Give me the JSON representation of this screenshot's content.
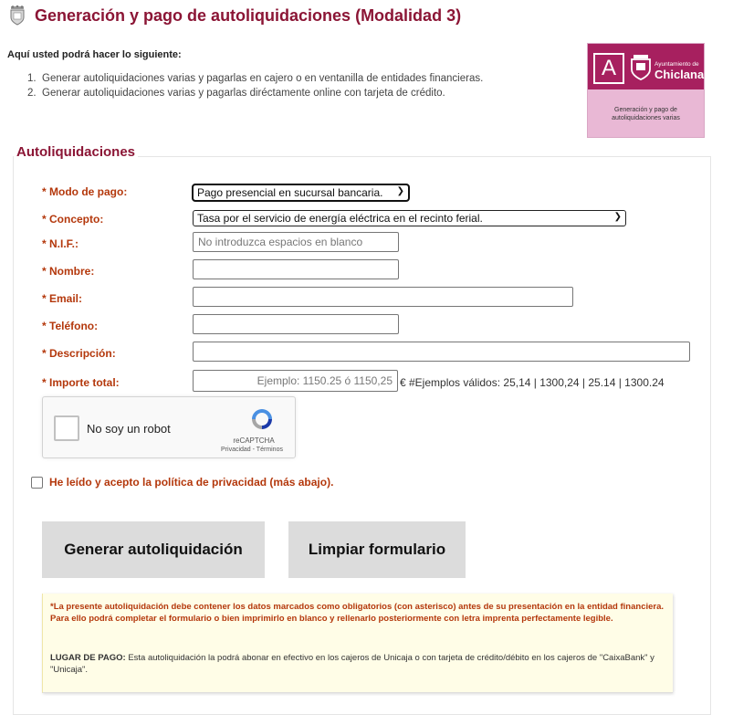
{
  "header": {
    "title": "Generación y pago de autoliquidaciones (Modalidad 3)"
  },
  "intro": {
    "heading": "Aquí usted podrá hacer lo siguiente:",
    "items": [
      {
        "num": "1.",
        "text": "Generar autoliquidaciones varias y pagarlas en cajero o en ventanilla de entidades financieras."
      },
      {
        "num": "2.",
        "text": "Generar autoliquidaciones varias y pagarlas diréctamente online con tarjeta de crédito."
      }
    ]
  },
  "logo": {
    "letter": "A",
    "small": "Ayuntamiento de",
    "city": "Chiclana",
    "caption_line1": "Generación y pago de",
    "caption_line2": "autoliquidaciones varias"
  },
  "form": {
    "legend": "Autoliquidaciones",
    "fields": {
      "modo_pago": {
        "label": "* Modo de pago:",
        "value": "Pago presencial en sucursal bancaria."
      },
      "concepto": {
        "label": "* Concepto:",
        "value": "Tasa por el servicio de energía eléctrica en el recinto ferial."
      },
      "nif": {
        "label": "* N.I.F.:",
        "placeholder": "No introduzca espacios en blanco"
      },
      "nombre": {
        "label": "* Nombre:",
        "value": ""
      },
      "email": {
        "label": "* Email:",
        "value": ""
      },
      "telefono": {
        "label": "* Teléfono:",
        "value": ""
      },
      "descripcion": {
        "label": "* Descripción:",
        "value": ""
      },
      "importe": {
        "label": "* Importe total:",
        "placeholder": "Ejemplo: 1150.25 ó 1150,25",
        "note": "€ #Ejemplos válidos: 25,14 | 1300,24 | 25.14 | 1300.24"
      }
    },
    "captcha": {
      "text": "No soy un robot",
      "brand": "reCAPTCHA",
      "links": "Privacidad - Términos"
    },
    "privacy_label": "He leído y acepto la política de privacidad (más abajo).",
    "buttons": {
      "generate": "Generar autoliquidación",
      "clear": "Limpiar formulario"
    }
  },
  "notice": {
    "warning": "*La presente autoliquidación debe contener los datos marcados como obligatorios (con asterisco) antes de su presentación en la entidad financiera. Para ello podrá completar el formulario o bien imprimirlo en blanco y rellenarlo posteriormente con letra imprenta perfectamente legible.",
    "place_label": "LUGAR DE PAGO:",
    "place_text": " Esta autoliquidación la podrá abonar en efectivo en los cajeros de Unicaja o con tarjeta de crédito/débito en los cajeros de \"CaixaBank\" y \"Unicaja\"."
  },
  "colors": {
    "title": "#8b1535",
    "label": "#b4380c",
    "logo": "#a7205f",
    "logo_light": "#e9b8d5",
    "notice_bg": "#fffde7",
    "button_bg": "#dcdcdc"
  }
}
